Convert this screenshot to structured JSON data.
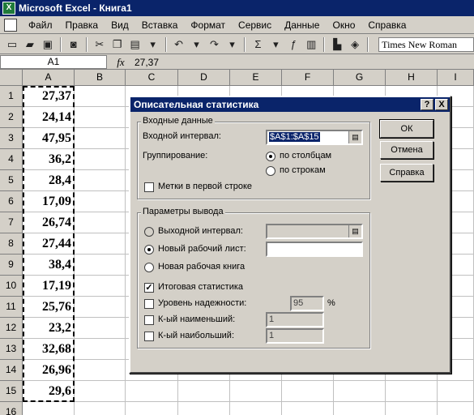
{
  "window": {
    "title": "Microsoft Excel - Книга1"
  },
  "menu": [
    "Файл",
    "Правка",
    "Вид",
    "Вставка",
    "Формат",
    "Сервис",
    "Данные",
    "Окно",
    "Справка"
  ],
  "toolbar": {
    "font_name": "Times New Roman"
  },
  "formula_bar": {
    "name_box": "A1",
    "fx": "fx",
    "value": "27,37"
  },
  "grid": {
    "columns": [
      "A",
      "B",
      "C",
      "D",
      "E",
      "F",
      "G",
      "H",
      "I"
    ],
    "rows": [
      {
        "n": "1",
        "a": "27,37"
      },
      {
        "n": "2",
        "a": "24,14"
      },
      {
        "n": "3",
        "a": "47,95"
      },
      {
        "n": "4",
        "a": "36,2"
      },
      {
        "n": "5",
        "a": "28,4"
      },
      {
        "n": "6",
        "a": "17,09"
      },
      {
        "n": "7",
        "a": "26,74"
      },
      {
        "n": "8",
        "a": "27,44"
      },
      {
        "n": "9",
        "a": "38,4"
      },
      {
        "n": "10",
        "a": "17,19"
      },
      {
        "n": "11",
        "a": "25,76"
      },
      {
        "n": "12",
        "a": "23,2"
      },
      {
        "n": "13",
        "a": "32,68"
      },
      {
        "n": "14",
        "a": "26,96"
      },
      {
        "n": "15",
        "a": "29,6"
      },
      {
        "n": "16",
        "a": ""
      }
    ]
  },
  "dialog": {
    "title": "Описательная статистика",
    "help_btn": "?",
    "close_btn": "X",
    "input_group": {
      "caption": "Входные данные",
      "range_label": "Входной интервал:",
      "range_value": "$A$1:$A$15",
      "grouping_label": "Группирование:",
      "by_columns": "по столбцам",
      "by_rows": "по строкам",
      "labels_first_row": "Метки в первой строке"
    },
    "output_group": {
      "caption": "Параметры вывода",
      "output_range": "Выходной интервал:",
      "new_sheet": "Новый рабочий лист:",
      "new_workbook": "Новая рабочая книга",
      "summary_stats": "Итоговая статистика",
      "confidence_level": "Уровень надежности:",
      "confidence_value": "95",
      "percent": "%",
      "kth_smallest": "К-ый наименьший:",
      "kth_smallest_value": "1",
      "kth_largest": "К-ый наибольший:",
      "kth_largest_value": "1"
    },
    "buttons": {
      "ok": "ОК",
      "cancel": "Отмена",
      "help": "Справка"
    }
  }
}
